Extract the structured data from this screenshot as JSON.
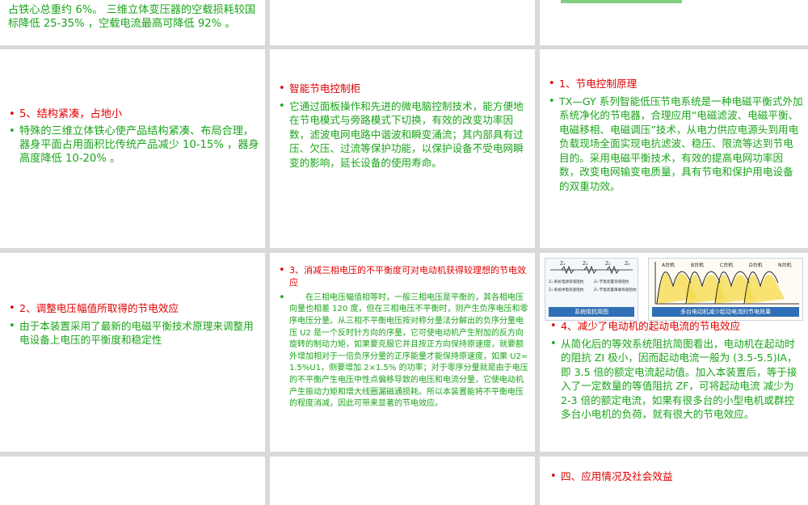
{
  "top_left": {
    "continuation": "占铁心总重约 6%。 三维立体变压器的空载损耗较国标降低 25-35% ，空载电流最高可降低 92% 。"
  },
  "row1": {
    "left": {
      "heading": "5、结构紧凑，占地小",
      "body": "特殊的三维立体铁心使产品结构紧凑、布局合理，器身平面占用面积比传统产品减少 10-15% ，器身高度降低 10-20% 。"
    },
    "middle": {
      "heading": "智能节电控制柜",
      "body": "它通过面板操作和先进的微电脑控制技术，能方便地在节电模式与旁路模式下切换，有效的改变功率因数，滤波电网电路中谐波和瞬变涌流；其内部具有过压、欠压、过流等保护功能，以保护设备不受电网瞬变的影响，延长设备的使用寿命。"
    },
    "right": {
      "heading": "1、节电控制原理",
      "body": "TX—GY 系列智能低压节电系统是一种电磁平衡式外加系统净化的节电器，合理应用“电磁滤波、电磁平衡、电磁移相、电磁调压”技术，从电力供应电源头到用电负载现场全面实现电抗滤波、稳压、限流等达到节电目的。采用电磁平衡技术，有效的提高电网功率因数，改变电网输变电质量，具有节电和保护用电设备的双重功效。"
    }
  },
  "row2": {
    "left": {
      "heading": "2、调整电压幅值所取得的节电效应",
      "body": "由于本装置采用了最新的电磁平衡技术原理来调整用电设备上电压的平衡度和稳定性"
    },
    "middle": {
      "heading": "3、消减三相电压的不平衡度可对电动机获得较理想的节电效应",
      "body": "在三相电压幅值相等时，一般三相电压是平衡的，其各相电压向量也相差 120 度，但在三相电压不平衡时，则产生负序电压和零序电压分量。从三相不平衡电压按对称分量法分解出的负序分量电压 U2 是一个反时针方向的序量，它可使电动机产生附加的反方向旋转的制动力矩，如果要克服它并且按正方向保持原速度，就要额外增加相对于一倍负序分量的正序能量才能保持原速度，如果 U2=1.5%U1，侧要增加 2×1.5% 的功率；对于零序分量就是由于电压的不平衡产生电压中性点偏移导致的电压和电流分量，它使电动机产生振动力矩和增大线圈漏磁通损耗。所以本装置能将不平衡电压的程度消减，因此可带来显著的节电效应。"
    },
    "right": {
      "figure_left": {
        "labels": [
          "Z₁",
          "Z₂",
          "Z₃",
          "Z₄"
        ],
        "legend": [
          "Z₁-系统电源等值阻抗",
          "Z₂-节电装置等值阻抗",
          "Z₃-系统供电等值阻抗",
          "Z₄-节电装置串联等值阻抗"
        ],
        "caption": "系统阻抗简图"
      },
      "figure_right": {
        "labels": [
          "A台机",
          "B台机",
          "C台机",
          "D台机",
          "N台机"
        ],
        "caption": "多台电动机减少起动电流的节电效果"
      },
      "heading": "4、减少了电动机的起动电流的节电效应",
      "body": "从简化后的等效系统阻抗简图看出，电动机在起动时的阻抗 ZI 极小，因而起动电流一般为 (3.5-5.5)IA，即 3.5 倍的额定电流起动值。加入本装置后，等于接入了一定数量的等值阻抗 ZF，可将起动电流 减少为 2-3 倍的额定电流，如果有很多台的小型电机或群控多台小电机的负荷，就有很大的节电效应。"
    }
  },
  "row3": {
    "right": {
      "heading": "四、应用情况及社会效益"
    }
  },
  "colors": {
    "heading_red": "#e00000",
    "body_green": "#1aa51a",
    "background_gray": "#d9d9d9",
    "cell_white": "#ffffff"
  }
}
